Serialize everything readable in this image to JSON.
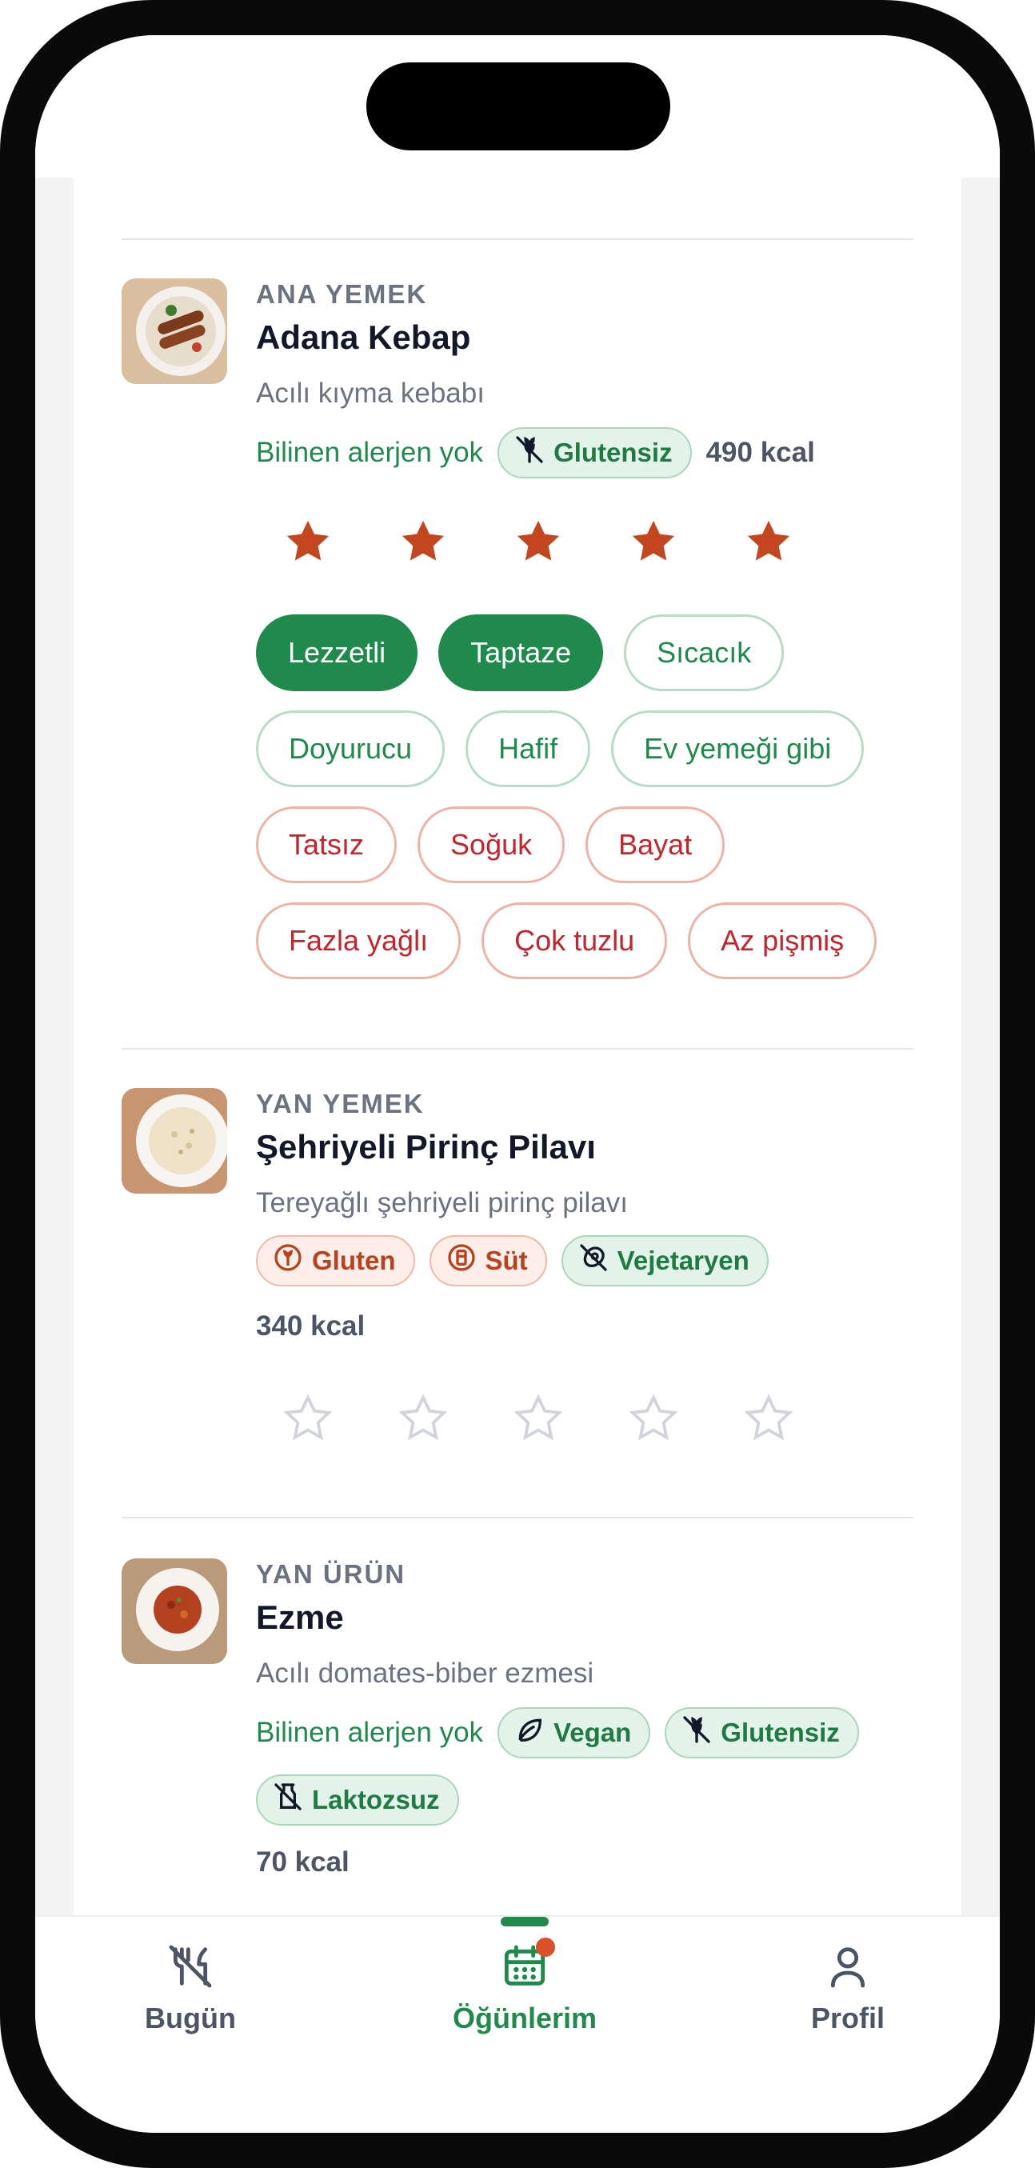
{
  "items": [
    {
      "category": "ANA YEMEK",
      "title": "Adana Kebap",
      "description": "Acılı kıyma kebabı",
      "allergen_note": "Bilinen alerjen yok",
      "badges": [
        {
          "label": "Glutensiz",
          "icon": "gluten-free-icon",
          "tone": "green"
        }
      ],
      "kcal": "490 kcal",
      "rating": 5,
      "rating_max": 5,
      "feedback_chips": [
        {
          "label": "Lezzetli",
          "state": "selected"
        },
        {
          "label": "Taptaze",
          "state": "selected"
        },
        {
          "label": "Sıcacık",
          "state": "positive"
        },
        {
          "label": "Doyurucu",
          "state": "positive"
        },
        {
          "label": "Hafif",
          "state": "positive"
        },
        {
          "label": "Ev yemeği gibi",
          "state": "positive"
        },
        {
          "label": "Tatsız",
          "state": "negative"
        },
        {
          "label": "Soğuk",
          "state": "negative"
        },
        {
          "label": "Bayat",
          "state": "negative"
        },
        {
          "label": "Fazla yağlı",
          "state": "negative"
        },
        {
          "label": "Çok tuzlu",
          "state": "negative"
        },
        {
          "label": "Az pişmiş",
          "state": "negative"
        }
      ]
    },
    {
      "category": "YAN YEMEK",
      "title": "Şehriyeli Pirinç Pilavı",
      "description": "Tereyağlı şehriyeli pirinç pilavı",
      "badges": [
        {
          "label": "Gluten",
          "icon": "wheat-icon",
          "tone": "red"
        },
        {
          "label": "Süt",
          "icon": "milk-icon",
          "tone": "red"
        },
        {
          "label": "Vejetaryen",
          "icon": "no-meat-icon",
          "tone": "green"
        }
      ],
      "kcal": "340 kcal",
      "rating": 0,
      "rating_max": 5
    },
    {
      "category": "YAN ÜRÜN",
      "title": "Ezme",
      "description": "Acılı domates-biber ezmesi",
      "allergen_note": "Bilinen alerjen yok",
      "badges": [
        {
          "label": "Vegan",
          "icon": "leaf-icon",
          "tone": "green"
        },
        {
          "label": "Glutensiz",
          "icon": "gluten-free-icon",
          "tone": "green"
        },
        {
          "label": "Laktozsuz",
          "icon": "lactose-free-icon",
          "tone": "green"
        }
      ],
      "kcal": "70 kcal",
      "rating": 0,
      "rating_max": 5
    }
  ],
  "tabs": [
    {
      "label": "Bugün",
      "icon": "utensils-off-icon",
      "active": false
    },
    {
      "label": "Öğünlerim",
      "icon": "calendar-icon",
      "active": true,
      "notification_dot": true
    },
    {
      "label": "Profil",
      "icon": "user-icon",
      "active": false
    }
  ],
  "colors": {
    "accent": "#1f8a4c",
    "star_filled": "#c4461f",
    "star_empty": "#d1d5db",
    "negative": "#c0262d",
    "allergen": "#b5431f"
  }
}
